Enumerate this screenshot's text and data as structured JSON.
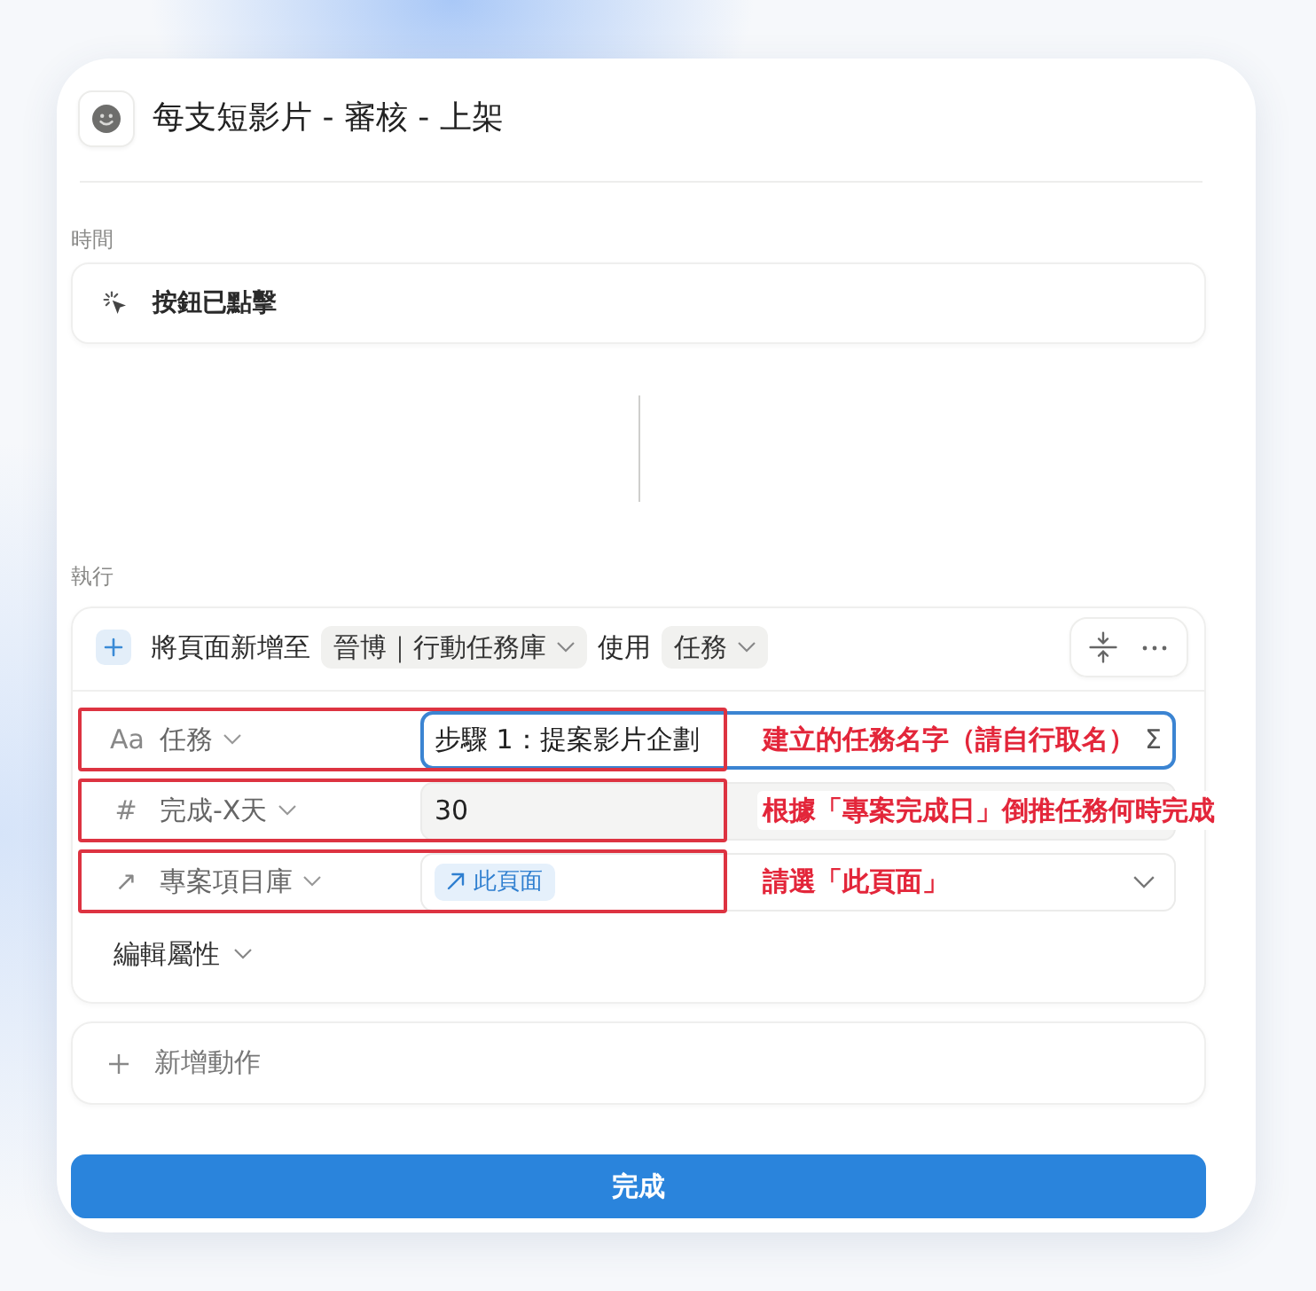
{
  "header": {
    "title": "每支短影片 - 審核 - 上架"
  },
  "trigger": {
    "section_label": "時間",
    "label": "按鈕已點擊"
  },
  "action_section": {
    "section_label": "執行",
    "action": {
      "verb": "將頁面新增至",
      "database": "晉博｜行動任務庫",
      "connector": "使用",
      "template": "任務",
      "properties": [
        {
          "kind": "title",
          "icon": "Aa",
          "name": "任務",
          "value": "步驟 1：提案影片企劃",
          "focused": true,
          "hovered": false,
          "highlighted": true,
          "annotation": "建立的任務名字（請自行取名）",
          "suffix": "Σ"
        },
        {
          "kind": "number",
          "icon": "#",
          "name": "完成-X天",
          "value": "30",
          "focused": false,
          "hovered": true,
          "highlighted": true,
          "annotation": "根據「專案完成日」倒推任務何時完成"
        },
        {
          "kind": "relation",
          "icon": "↗",
          "name": "專案項目庫",
          "chip": "此頁面",
          "focused": false,
          "hovered": false,
          "highlighted": true,
          "annotation": "請選「此頁面」"
        }
      ],
      "edit_properties": "編輯屬性"
    },
    "add_action": "新增動作"
  },
  "done_button": "完成"
}
